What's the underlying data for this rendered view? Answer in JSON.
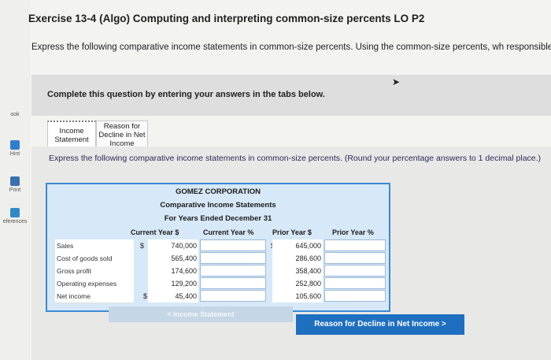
{
  "title": "Exercise 13-4 (Algo) Computing and interpreting common-size percents LO P2",
  "intro": "Express the following comparative income statements in common-size percents. Using the common-size percents, wh responsible for the decline in net income?",
  "complete_prompt": "Complete this question by entering your answers in the tabs below.",
  "rail": {
    "book": "ook",
    "hint": "Hint",
    "print": "Print",
    "references": "eferences"
  },
  "tabs": [
    {
      "label": "Income Statement"
    },
    {
      "label": "Reason for Decline in Net Income"
    }
  ],
  "instruction": "Express the following comparative income statements in common-size percents. (Round your percentage answers to 1 decimal place.)",
  "statement": {
    "company": "GOMEZ CORPORATION",
    "subtitle": "Comparative Income Statements",
    "period": "For Years Ended December 31",
    "columns": {
      "current_dollar": "Current Year $",
      "current_pct": "Current Year %",
      "prior_dollar": "Prior Year $",
      "prior_pct": "Prior Year %"
    },
    "rows": [
      {
        "label": "Sales",
        "current": "740,000",
        "prior": "645,000",
        "cur_dollar": "$",
        "prior_dollar_sign": "$"
      },
      {
        "label": "Cost of goods sold",
        "current": "565,400",
        "prior": "286,600"
      },
      {
        "label": "Gross profit",
        "current": "174,600",
        "prior": "358,400"
      },
      {
        "label": "Operating expenses",
        "current": "129,200",
        "prior": "252,800"
      },
      {
        "label": "Net income",
        "current": "45,400",
        "prior": "105,600",
        "cur_dollar": "$",
        "prior_dollar_sign": "$"
      }
    ]
  },
  "buttons": {
    "prev": "< Income Statement",
    "next": "Reason for Decline in Net Income >"
  }
}
